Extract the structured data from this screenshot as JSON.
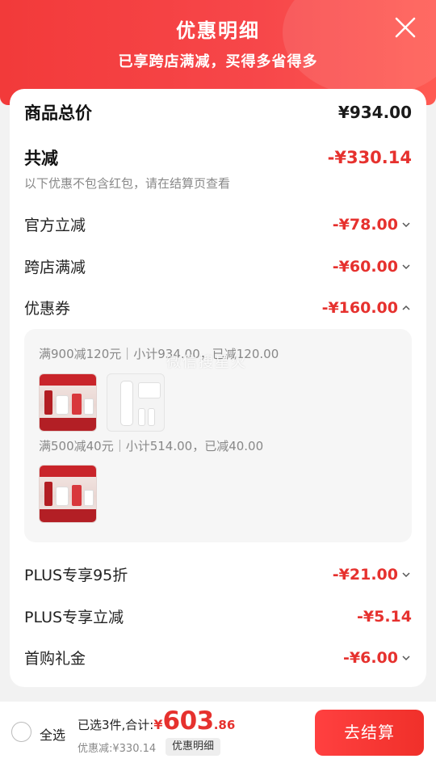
{
  "header": {
    "title": "优惠明细",
    "subtitle": "已享跨店满减，买得多省得多"
  },
  "summary": {
    "total_label": "商品总价",
    "total_value": "¥934.00",
    "reduce_label": "共减",
    "reduce_value": "-¥330.14",
    "note": "以下优惠不包含红包，请在结算页查看"
  },
  "discounts": [
    {
      "label": "官方立减",
      "value": "-¥78.00",
      "expand": "collapsed"
    },
    {
      "label": "跨店满减",
      "value": "-¥60.00",
      "expand": "collapsed"
    },
    {
      "label": "优惠券",
      "value": "-¥160.00",
      "expand": "expanded"
    },
    {
      "label": "PLUS专享95折",
      "value": "-¥21.00",
      "expand": "collapsed"
    },
    {
      "label": "PLUS专享立减",
      "value": "-¥5.14"
    },
    {
      "label": "首购礼金",
      "value": "-¥6.00",
      "expand": "collapsed"
    }
  ],
  "coupons": [
    {
      "text": "满900减120元｜小计934.00，已减120.00"
    },
    {
      "text": "满500减40元｜小计514.00，已减40.00"
    }
  ],
  "watermark": "微信搜星火",
  "bottom": {
    "select_all": "全选",
    "selected_text": "已选3件,合计:",
    "currency": "¥",
    "amount_int": "603",
    "amount_dec": ".86",
    "saved_text": "优惠减:¥330.14",
    "detail_label": "优惠明细",
    "checkout_label": "去结算"
  },
  "colors": {
    "accent": "#e6312e",
    "header_bg": "#f23a3a"
  }
}
